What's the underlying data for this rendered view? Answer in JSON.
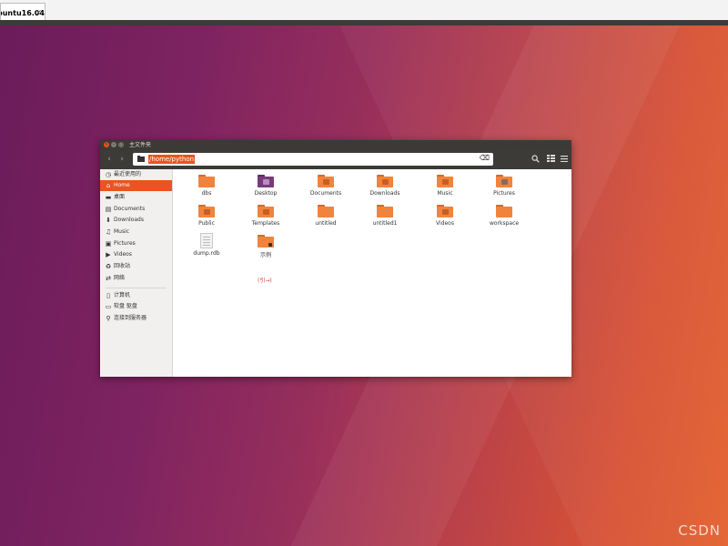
{
  "vm": {
    "tab_label": "buntu16.04",
    "tab_close": "✕"
  },
  "window": {
    "title": "主文件夹",
    "close_glyph": "×",
    "min_glyph": "–",
    "max_glyph": "□"
  },
  "toolbar": {
    "back": "‹",
    "forward": "›",
    "path": "/home/python",
    "clear": "⌫",
    "search_icon": "search-icon",
    "view_icon": "list-view-icon",
    "menu_icon": "hamburger-menu-icon"
  },
  "sidebar": {
    "items": [
      {
        "label": "最近使用的",
        "icon": "recent-icon",
        "glyph": "◷"
      },
      {
        "label": "Home",
        "icon": "home-icon",
        "glyph": "⌂"
      },
      {
        "label": "桌面",
        "icon": "desktop-icon",
        "glyph": "▬"
      },
      {
        "label": "Documents",
        "icon": "documents-icon",
        "glyph": "▤"
      },
      {
        "label": "Downloads",
        "icon": "downloads-icon",
        "glyph": "⬇"
      },
      {
        "label": "Music",
        "icon": "music-icon",
        "glyph": "♫"
      },
      {
        "label": "Pictures",
        "icon": "pictures-icon",
        "glyph": "▣"
      },
      {
        "label": "Videos",
        "icon": "videos-icon",
        "glyph": "▶"
      },
      {
        "label": "回收站",
        "icon": "trash-icon",
        "glyph": "♻"
      },
      {
        "label": "网络",
        "icon": "network-icon",
        "glyph": "⇄"
      },
      {
        "label": "计算机",
        "icon": "computer-icon",
        "glyph": "▯"
      },
      {
        "label": "软盘 驱盘",
        "icon": "floppy-icon",
        "glyph": "▭"
      },
      {
        "label": "连接到服务器",
        "icon": "server-icon",
        "glyph": "⚲"
      }
    ]
  },
  "files": [
    {
      "name": "dbs"
    },
    {
      "name": "Desktop"
    },
    {
      "name": "Documents"
    },
    {
      "name": "Downloads"
    },
    {
      "name": "Music"
    },
    {
      "name": "Pictures"
    },
    {
      "name": "Public"
    },
    {
      "name": "Templates"
    },
    {
      "name": "untitled"
    },
    {
      "name": "untitled1"
    },
    {
      "name": "Videos"
    },
    {
      "name": "workspace"
    },
    {
      "name": "dump.rdb"
    },
    {
      "name": "示例"
    }
  ],
  "annotation": "(引→)",
  "watermark": "CSDN",
  "colors": {
    "accent": "#e95420",
    "folder": "#f0843d",
    "annotation": "#e03a3a"
  }
}
